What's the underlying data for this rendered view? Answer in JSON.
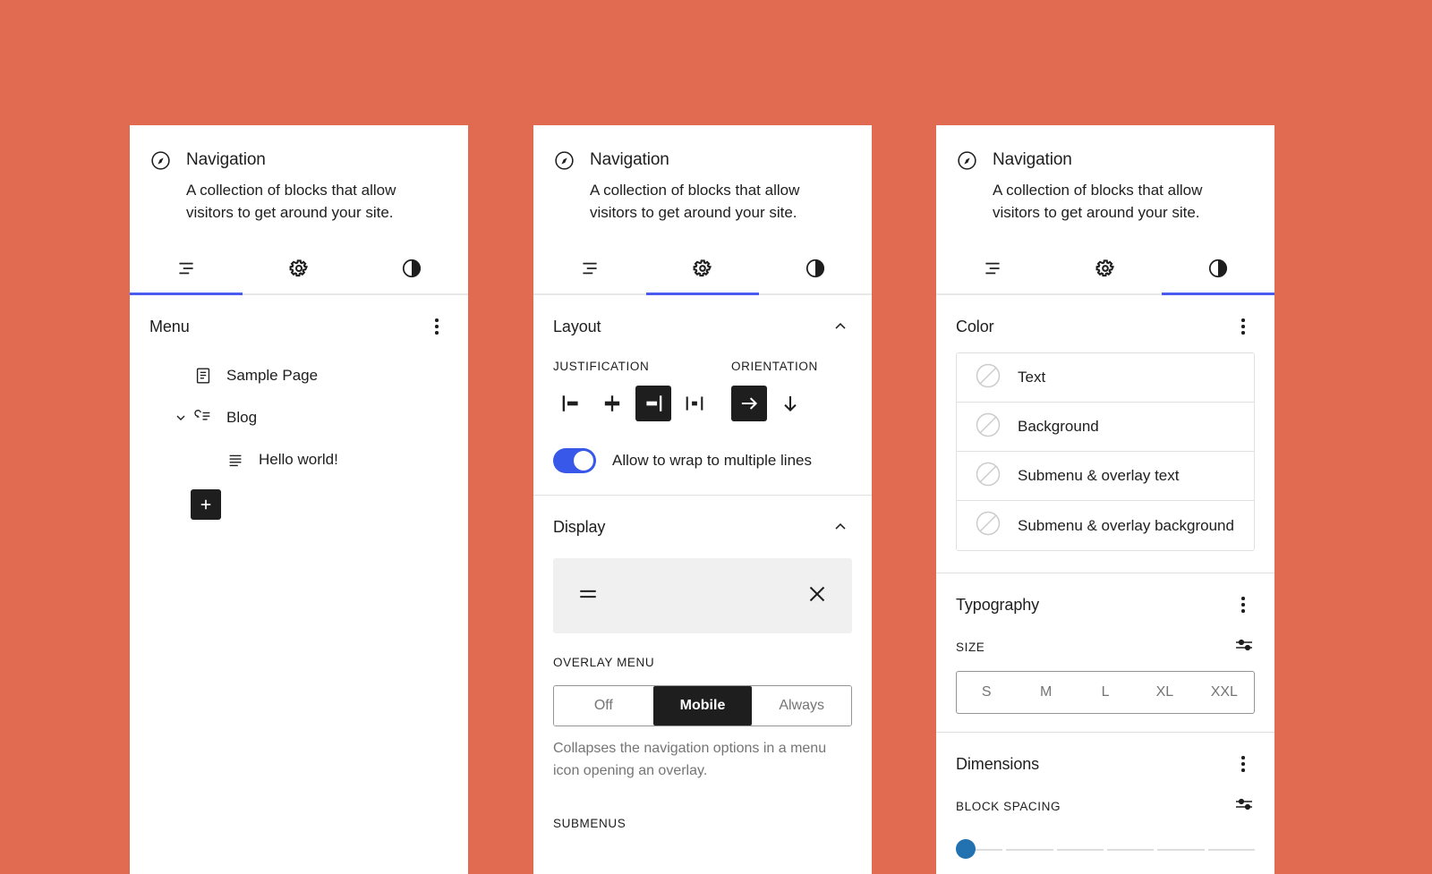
{
  "background_color": "#e06b50",
  "accent_color": "#4a5cf0",
  "block": {
    "icon": "compass-icon",
    "title": "Navigation",
    "description": "A collection of blocks that allow visitors to get around your site."
  },
  "tabs": [
    {
      "id": "list-view",
      "icon": "list-view-icon",
      "label": "List View"
    },
    {
      "id": "settings",
      "icon": "gear-icon",
      "label": "Settings"
    },
    {
      "id": "styles",
      "icon": "half-circle-icon",
      "label": "Styles"
    }
  ],
  "panel1": {
    "active_tab_index": 0,
    "menu": {
      "title": "Menu",
      "items": [
        {
          "label": "Sample Page",
          "icon": "page-icon",
          "depth": 1,
          "expandable": false
        },
        {
          "label": "Blog",
          "icon": "post-list-icon",
          "depth": 1,
          "expandable": true,
          "expanded": true
        },
        {
          "label": "Hello world!",
          "icon": "paragraph-icon",
          "depth": 2,
          "expandable": false
        }
      ],
      "add_button_label": "+"
    }
  },
  "panel2": {
    "active_tab_index": 1,
    "layout": {
      "title": "Layout",
      "collapsed": false,
      "justification": {
        "label": "Justification",
        "options": [
          {
            "id": "left",
            "icon": "justify-left-icon",
            "selected": false
          },
          {
            "id": "center",
            "icon": "justify-center-icon",
            "selected": false
          },
          {
            "id": "right",
            "icon": "justify-right-icon",
            "selected": true
          },
          {
            "id": "space-between",
            "icon": "justify-space-between-icon",
            "selected": false
          }
        ]
      },
      "orientation": {
        "label": "Orientation",
        "options": [
          {
            "id": "horizontal",
            "icon": "arrow-right-icon",
            "selected": true
          },
          {
            "id": "vertical",
            "icon": "arrow-down-icon",
            "selected": false
          }
        ]
      },
      "wrap_toggle": {
        "label": "Allow to wrap to multiple lines",
        "enabled": true
      }
    },
    "display": {
      "title": "Display",
      "collapsed": false,
      "preview": {
        "open_icon": "hamburger-icon",
        "close_icon": "close-icon"
      },
      "overlay_menu": {
        "label": "Overlay Menu",
        "options": [
          "Off",
          "Mobile",
          "Always"
        ],
        "selected": "Mobile",
        "help": "Collapses the navigation options in a menu icon opening an overlay."
      },
      "submenus_label": "Submenus"
    }
  },
  "panel3": {
    "active_tab_index": 2,
    "color": {
      "title": "Color",
      "rows": [
        {
          "label": "Text",
          "swatch": "none-swatch-icon"
        },
        {
          "label": "Background",
          "swatch": "none-swatch-icon"
        },
        {
          "label": "Submenu & overlay text",
          "swatch": "none-swatch-icon"
        },
        {
          "label": "Submenu & overlay background",
          "swatch": "none-swatch-icon"
        }
      ]
    },
    "typography": {
      "title": "Typography",
      "size_label": "Size",
      "sizes": [
        "S",
        "M",
        "L",
        "XL",
        "XXL"
      ],
      "selected_size": ""
    },
    "dimensions": {
      "title": "Dimensions",
      "block_spacing_label": "Block spacing",
      "slider_value": 0,
      "slider_steps": 6,
      "thumb_color": "#2271b1"
    }
  }
}
